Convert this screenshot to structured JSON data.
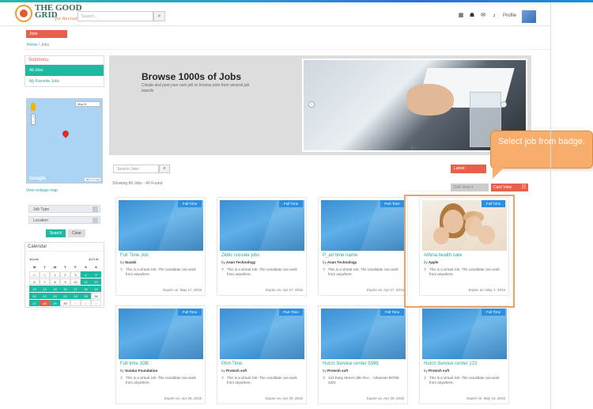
{
  "header": {
    "logo_line1": "THE GOOD",
    "logo_line2": "GRID",
    "logo_tagline": "for Recruiting",
    "search_placeholder": "Search...",
    "profile_label": "Profile"
  },
  "nav": {
    "jobs_tab": "Jobs"
  },
  "breadcrumb": {
    "home": "Home",
    "sep": "/",
    "current": "Jobs"
  },
  "submenu": {
    "title": "Submenu",
    "all_jobs": "All Jobs",
    "favorite_jobs": "My Favorite Jobs"
  },
  "map": {
    "type_label": "Map",
    "google_label": "Google",
    "terms_label": "Terms of Use",
    "enlarge_link": "View enlarge map"
  },
  "filters": {
    "job_type": "Job Type",
    "location": "Location",
    "search_button": "Search",
    "clear_button": "Clear"
  },
  "calendar": {
    "title": "Calendar",
    "month": "April",
    "year": "2015",
    "weekdays": [
      "M",
      "T",
      "W",
      "T",
      "F",
      "S",
      "S"
    ]
  },
  "banner": {
    "title": "Browse 1000s of Jobs",
    "subtitle": "Create and post your own job or browse jobs from several job boards"
  },
  "toolbar": {
    "search_placeholder": "Search Jobs",
    "sort_label": "Latest",
    "showing_text": "Showing All Jobs - 40 Found",
    "grid_label": "Grid View",
    "card_view_label": "Card View"
  },
  "jobs": [
    {
      "badge": "Full Time",
      "title": "Full Time Job",
      "company": "Suzaki",
      "desc": "This is a virtual Job. The candidate can work from anywhere.",
      "expire": "Expire on:  May 17, 2015"
    },
    {
      "badge": "Full Time",
      "title": "Zkttic cresate jobs",
      "company": "Asan Technology",
      "desc": "This is a virtual Job. The candidate can work from anywhere.",
      "expire": "Expire on:  Apr 27, 2015"
    },
    {
      "badge": "Part-Time",
      "title": "P_art time name",
      "company": "Asan Technology",
      "desc": "This is a virtual Job. The candidate can work from anywhere.",
      "expire": "Expire on:  Apr 27, 2015"
    },
    {
      "badge": "Full Time",
      "title": "Athina health care",
      "company": "Apple",
      "desc": "This is a virtual Job. The candidate can work from anywhere.",
      "expire": "Expire on:  May 1, 2015"
    },
    {
      "badge": "Full Time",
      "title": "Full time JOB",
      "company": "Sundar Foundation",
      "desc": "This is a virtual Job. The candidate can work from anywhere.",
      "expire": "Expire on:  Apr 28, 2015"
    },
    {
      "badge": "Part-Time",
      "title": "PArt-Time",
      "company": "Protech soft",
      "desc": "This is a virtual Job. The candidate can work from anywhere.",
      "expire": "Expire on:  Apr 28, 2015"
    },
    {
      "badge": "Full Time",
      "title": "Hutch Service center 5598",
      "company": "Protech soft",
      "desc": "123 Easy Street Little Roc... Arkansas 98765-4321",
      "expire": "Expire on:  Apr 28, 2015"
    },
    {
      "badge": "Full Time",
      "title": "Hutch Service center 123",
      "company": "Protech soft",
      "desc": "This is a virtual Job. The candidate can work from anywhere.",
      "expire": "Expire on:  May 16, 2015"
    }
  ],
  "card_by_prefix": "by",
  "callout": {
    "text": "Select job from badge."
  },
  "colors": {
    "accent": "#1fb9a2",
    "orange": "#e8604c",
    "badge_blue": "#2d8fe0",
    "callout": "#f7ad6b"
  }
}
